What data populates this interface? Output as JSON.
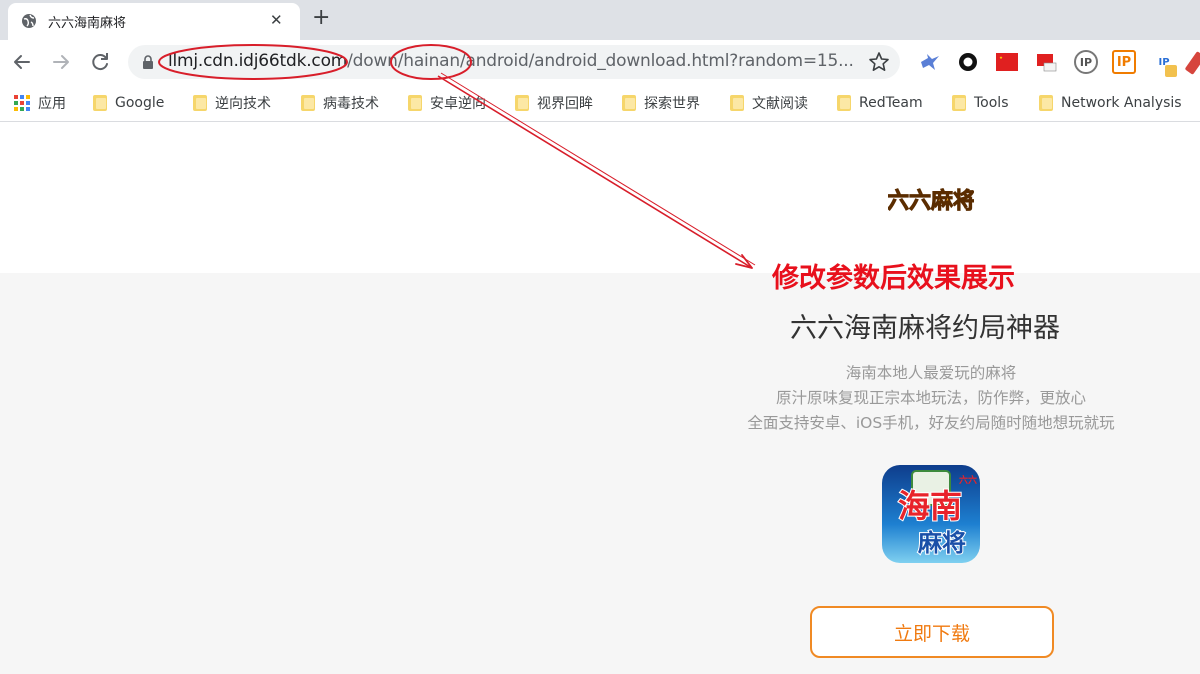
{
  "tab": {
    "title": "六六海南麻将",
    "close_glyph": "✕",
    "new_tab_glyph": "+"
  },
  "omnibox": {
    "url_host": "llmj.cdn.idj66tdk.com",
    "url_path": "/down/hainan/android/android_download.html?random=15..."
  },
  "bookmarks": [
    {
      "label": "应用",
      "icon": "apps-grid-icon"
    },
    {
      "label": "Google",
      "icon": "folder-icon"
    },
    {
      "label": "逆向技术",
      "icon": "folder-icon"
    },
    {
      "label": "病毒技术",
      "icon": "folder-icon"
    },
    {
      "label": "安卓逆向",
      "icon": "folder-icon"
    },
    {
      "label": "视界回眸",
      "icon": "folder-icon"
    },
    {
      "label": "探索世界",
      "icon": "folder-icon"
    },
    {
      "label": "文献阅读",
      "icon": "folder-icon"
    },
    {
      "label": "RedTeam",
      "icon": "folder-icon"
    },
    {
      "label": "Tools",
      "icon": "folder-icon"
    },
    {
      "label": "Network Analysis",
      "icon": "folder-icon"
    }
  ],
  "extensions": [
    {
      "name": "bird-extension-icon"
    },
    {
      "name": "ring-extension-icon"
    },
    {
      "name": "china-flag-extension-icon"
    },
    {
      "name": "flag-badge-extension-icon",
      "text": ""
    },
    {
      "name": "ip-location-extension-icon",
      "text": "IP"
    },
    {
      "name": "ip-orange-extension-icon",
      "text": "IP"
    },
    {
      "name": "ip-question-extension-icon",
      "text": "IP"
    }
  ],
  "page": {
    "logo_text": "六六麻将",
    "annotation": "修改参数后效果展示",
    "headline": "六六海南麻将约局神器",
    "descriptions": [
      "海南本地人最爱玩的麻将",
      "原汁原味复现正宗本地玩法，防作弊，更放心",
      "全面支持安卓、iOS手机，好友约局随时随地想玩就玩"
    ],
    "app_icon_text_top": "海南",
    "app_icon_text_bottom": "麻将",
    "app_icon_badge": "六六",
    "download_label": "立即下载"
  },
  "colors": {
    "annotation_red": "#e8101c",
    "download_orange": "#f08a24",
    "ellipse_red": "#d81e2a"
  }
}
